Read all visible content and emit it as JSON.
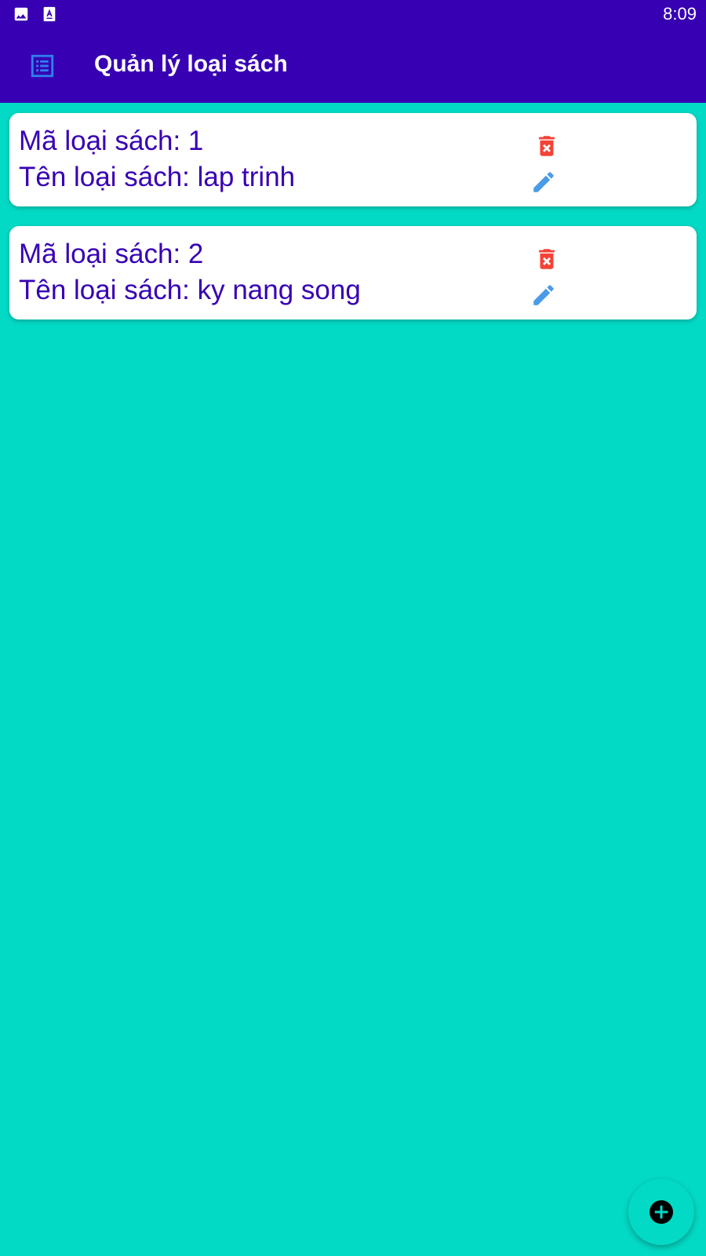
{
  "status_bar": {
    "time": "8:09",
    "icons": [
      "image-icon",
      "text-format-icon"
    ]
  },
  "app_bar": {
    "title": "Quản lý loại sách",
    "menu_icon": "list-icon"
  },
  "categories": [
    {
      "code_line": "Mã loại sách: 1",
      "name_line": "Tên loại sách: lap trinh"
    },
    {
      "code_line": "Mã loại sách: 2",
      "name_line": "Tên loại sách: ky nang song"
    }
  ],
  "actions": {
    "delete_icon": "delete-forever-icon",
    "edit_icon": "pencil-icon",
    "fab_icon": "add-circle-icon"
  },
  "colors": {
    "primary": "#3700B3",
    "background": "#03DAC5",
    "card": "#FFFFFF",
    "text": "#3700B3",
    "delete": "#F44336",
    "edit": "#4A9BE8"
  }
}
